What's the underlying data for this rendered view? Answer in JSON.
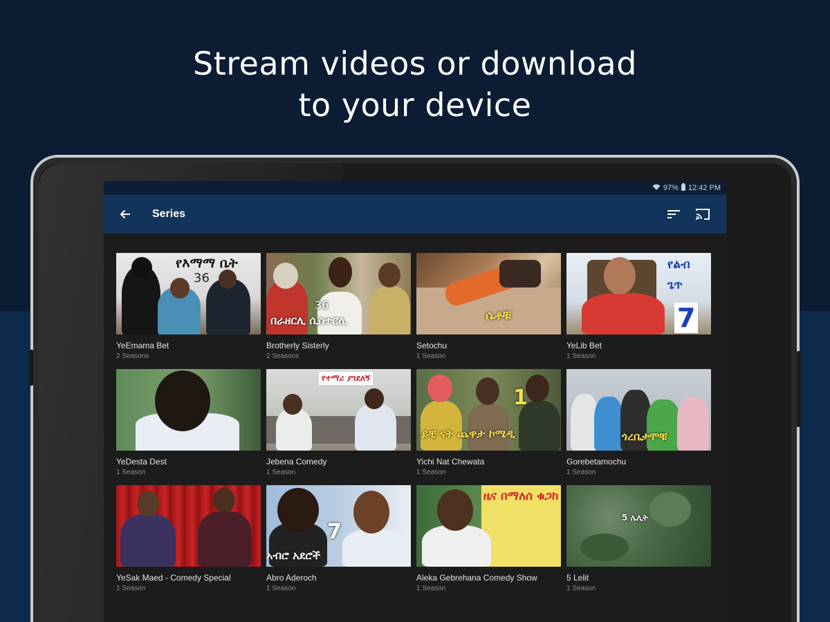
{
  "promo": {
    "line1": "Stream videos or download",
    "line2": "to your device"
  },
  "status_bar": {
    "battery": "97%",
    "time": "12:42 PM",
    "icons": [
      "wifi-icon",
      "battery-icon"
    ]
  },
  "app_bar": {
    "title": "Series",
    "icons": [
      "back-arrow-icon",
      "sort-icon",
      "cast-icon"
    ]
  },
  "series": [
    {
      "title": "YeEmama Bet",
      "seasons": "2 Seasons",
      "thumb_text": "የእማማ ቤት",
      "thumb_number": "36"
    },
    {
      "title": "Brotherly Sisterly",
      "seasons": "2 Seasons",
      "thumb_text": "በራዘርሊ ሲስተርሊ",
      "thumb_number": "36"
    },
    {
      "title": "Setochu",
      "seasons": "1 Season",
      "thumb_text": "ሴቶቹ"
    },
    {
      "title": "YeLib Bet",
      "seasons": "1 Season",
      "thumb_text": "የልብ ጌጥ",
      "thumb_number": "7"
    },
    {
      "title": "YeDesta Dest",
      "seasons": "1 Season"
    },
    {
      "title": "Jebena Comedy",
      "seasons": "1 Season",
      "thumb_text": "የተማሪ ያገደለኝ"
    },
    {
      "title": "Yichi Nat Chewata",
      "seasons": "1 Season",
      "thumb_text": "ይቺ ናት ጨዋታ ኮሜዲ",
      "thumb_number": "1"
    },
    {
      "title": "Gorebetamochu",
      "seasons": "1 Season",
      "thumb_text": "ጎረቤታሞቹ"
    },
    {
      "title": "YeSak Maed - Comedy Special",
      "seasons": "1 Season"
    },
    {
      "title": "Abro Aderoch",
      "seasons": "1 Season",
      "thumb_text": "አብሮ አደሮች",
      "thumb_number": "7"
    },
    {
      "title": "Aleka Gebrehana Comedy Show",
      "seasons": "1 Season",
      "thumb_text": "ዜና በማለሰ ቁጋከ"
    },
    {
      "title": "5 Lelit",
      "seasons": "1 Season",
      "thumb_text": "5 ሌሊት"
    }
  ],
  "colors": {
    "bg_top": "#0b1c33",
    "bg_bottom": "#0d2a4a",
    "app_bar": "#12345a",
    "status_bar": "#0b1e36",
    "screen_bg": "#1c1c1c"
  }
}
